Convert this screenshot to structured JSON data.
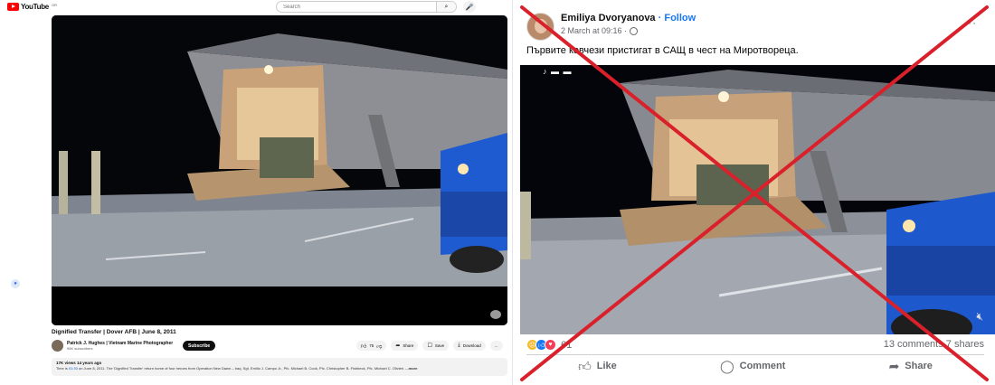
{
  "youtube": {
    "logo_text": "YouTube",
    "logo_sup": "GR",
    "search_placeholder": "Search",
    "video_title": "Dignified Transfer | Dover AFB | June 8, 2011",
    "channel_name": "Patrick J. Hughes | Vietnam Marine Photographer",
    "channel_subs": "98K subscribers",
    "subscribe_label": "Subscribe",
    "likes": "75",
    "share_label": "Share",
    "save_label": "Save",
    "download_label": "Download",
    "more_label": "...",
    "views_line": "17K views  14 years ago",
    "description_prefix": "Time is ",
    "description_time": "01:30",
    "description_rest": " on June 8, 2011.  The 'Dignified Transfer' return home of four heroes from Operation New Dawn – Iraq.  Sgt. Emilio J. Campo Jr., Pfc.  Michael B. Cook, Pfc.  Christopher B. Fishbeck, Pfc.  Michael C. Olivieri.",
    "description_more": " ...more"
  },
  "facebook": {
    "author": "Emiliya Dvoryanova",
    "separator": " · ",
    "follow_label": "Follow",
    "timestamp": "2 March at 09:16 ·",
    "more_icon": "···",
    "post_text": "Първите ковчези пристигат в САЩ в чест на Миротвореца.",
    "reaction_count": "61",
    "comments": "13 comments",
    "shares": "7 shares",
    "like_label": "Like",
    "comment_label": "Comment",
    "share_label": "Share",
    "cross_color": "#d9202b"
  }
}
